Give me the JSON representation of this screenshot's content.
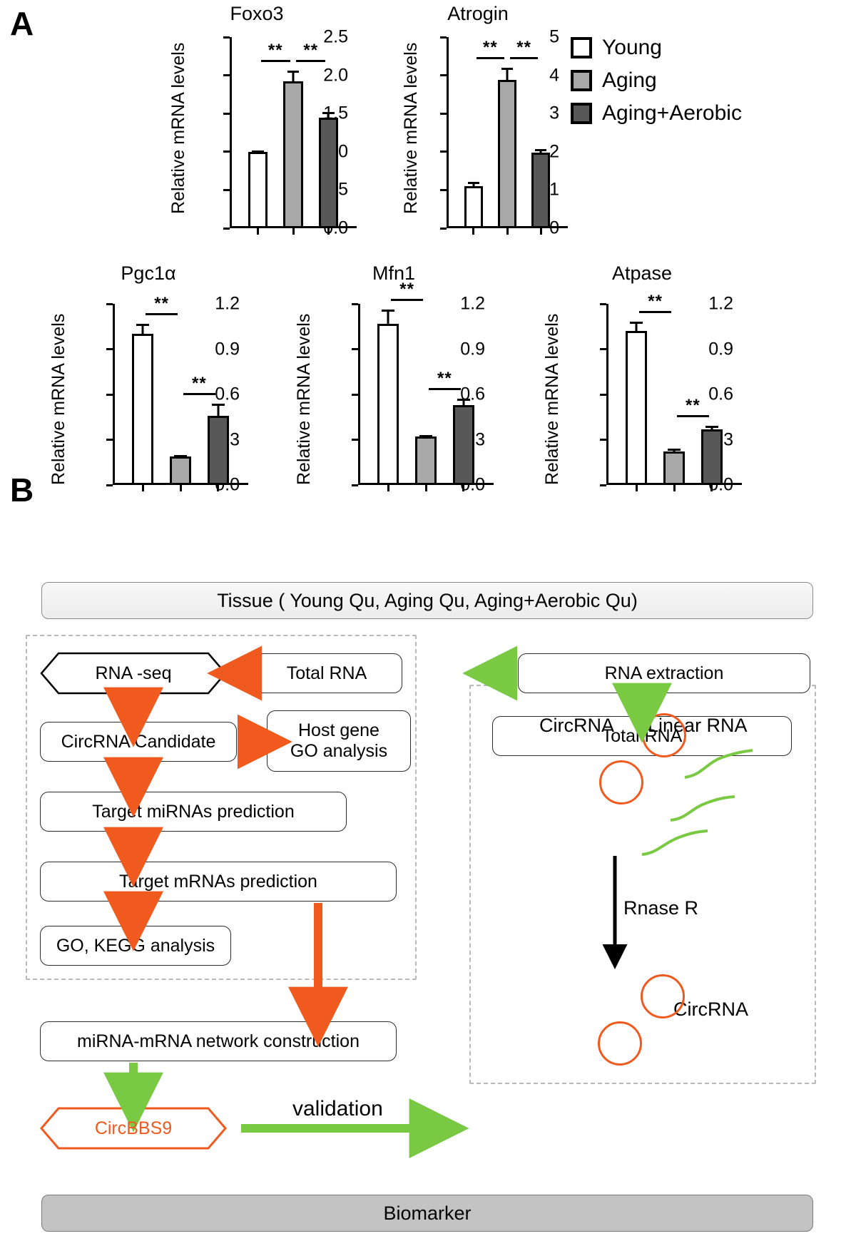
{
  "panels": {
    "a_letter": "A",
    "b_letter": "B"
  },
  "legend": {
    "items": [
      {
        "label": "Young",
        "swatch": "young",
        "color": "#ffffff"
      },
      {
        "label": "Aging",
        "swatch": "aging",
        "color": "#a8a8a8"
      },
      {
        "label": "Aging+Aerobic",
        "swatch": "aero",
        "color": "#585858"
      }
    ]
  },
  "chart_data": [
    {
      "type": "bar",
      "title": "Foxo3",
      "ylabel": "Relative mRNA levels",
      "xlabel": "",
      "categories": [
        "Young",
        "Aging",
        "Aging+Aerobic"
      ],
      "values": [
        1.0,
        1.92,
        1.45
      ],
      "errors": [
        0.02,
        0.14,
        0.07
      ],
      "ylim": [
        0.0,
        2.5
      ],
      "yticks": [
        0.0,
        0.5,
        1.0,
        1.5,
        2.0,
        2.5
      ],
      "yticklabels": [
        "0.0",
        "0.5",
        "1.0",
        "1.5",
        "2.0",
        "2.5"
      ],
      "grid": false,
      "annotations": [
        {
          "text": "**",
          "from": "Young",
          "to": "Aging"
        },
        {
          "text": "**",
          "from": "Aging",
          "to": "Aging+Aerobic"
        }
      ]
    },
    {
      "type": "bar",
      "title": "Atrogin",
      "ylabel": "Relative mRNA levels",
      "xlabel": "",
      "categories": [
        "Young",
        "Aging",
        "Aging+Aerobic"
      ],
      "values": [
        1.1,
        3.88,
        1.97
      ],
      "errors": [
        0.12,
        0.32,
        0.11
      ],
      "ylim": [
        0,
        5
      ],
      "yticks": [
        0,
        1,
        2,
        3,
        4,
        5
      ],
      "yticklabels": [
        "0",
        "1",
        "2",
        "3",
        "4",
        "5"
      ],
      "grid": false,
      "annotations": [
        {
          "text": "**",
          "from": "Young",
          "to": "Aging"
        },
        {
          "text": "**",
          "from": "Aging",
          "to": "Aging+Aerobic"
        }
      ]
    },
    {
      "type": "bar",
      "title": "Pgc1α",
      "ylabel": "Relative mRNA levels",
      "xlabel": "",
      "categories": [
        "Young",
        "Aging",
        "Aging+Aerobic"
      ],
      "values": [
        1.0,
        0.19,
        0.46
      ],
      "errors": [
        0.07,
        0.01,
        0.08
      ],
      "ylim": [
        0.0,
        1.2
      ],
      "yticks": [
        0.0,
        0.3,
        0.6,
        0.9,
        1.2
      ],
      "yticklabels": [
        "0.0",
        "0.3",
        "0.6",
        "0.9",
        "1.2"
      ],
      "grid": false,
      "annotations": [
        {
          "text": "**",
          "from": "Young",
          "to": "Aging"
        },
        {
          "text": "**",
          "from": "Aging",
          "to": "Aging+Aerobic"
        }
      ]
    },
    {
      "type": "bar",
      "title": "Mfn1",
      "ylabel": "Relative mRNA levels",
      "xlabel": "",
      "categories": [
        "Young",
        "Aging",
        "Aging+Aerobic"
      ],
      "values": [
        1.07,
        0.32,
        0.53
      ],
      "errors": [
        0.09,
        0.01,
        0.04
      ],
      "ylim": [
        0.0,
        1.2
      ],
      "yticks": [
        0.0,
        0.3,
        0.6,
        0.9,
        1.2
      ],
      "yticklabels": [
        "0.0",
        "0.3",
        "0.6",
        "0.9",
        "1.2"
      ],
      "grid": false,
      "annotations": [
        {
          "text": "**",
          "from": "Young",
          "to": "Aging"
        },
        {
          "text": "**",
          "from": "Aging",
          "to": "Aging+Aerobic"
        }
      ]
    },
    {
      "type": "bar",
      "title": "Atpase",
      "ylabel": "Relative mRNA levels",
      "xlabel": "",
      "categories": [
        "Young",
        "Aging",
        "Aging+Aerobic"
      ],
      "values": [
        1.02,
        0.22,
        0.37
      ],
      "errors": [
        0.06,
        0.02,
        0.02
      ],
      "ylim": [
        0.0,
        1.2
      ],
      "yticks": [
        0.0,
        0.3,
        0.6,
        0.9,
        1.2
      ],
      "yticklabels": [
        "0.0",
        "0.3",
        "0.6",
        "0.9",
        "1.2"
      ],
      "grid": false,
      "annotations": [
        {
          "text": "**",
          "from": "Young",
          "to": "Aging"
        },
        {
          "text": "**",
          "from": "Aging",
          "to": "Aging+Aerobic"
        }
      ]
    }
  ],
  "flowchart": {
    "tissue_bar": "Tissue ( Young Qu, Aging Qu, Aging+Aerobic Qu)",
    "biomarker_bar": "Biomarker",
    "nodes": {
      "rna_seq": "RNA -seq",
      "total_rna_left": "Total RNA",
      "rna_extraction": "RNA extraction",
      "circrna_candidate": "CircRNA Candidate",
      "host_gene_go": "Host gene\nGO analysis",
      "target_mirnas": "Target miRNAs prediction",
      "target_mrnas": "Target mRNAs prediction",
      "go_kegg": "GO, KEGG analysis",
      "network": "miRNA-mRNA network construction",
      "circbbs9": "CircBBS9",
      "total_rna_right": "Total RNA"
    },
    "labels": {
      "validation": "validation",
      "circrna_top": "CircRNA",
      "linear_rna": "Linear RNA",
      "rnase_r": "Rnase R",
      "circrna_bottom": "CircRNA"
    },
    "colors": {
      "orange": "#f15a1e",
      "green": "#7ac943",
      "black": "#000000",
      "dash_gray": "#b9b9b9"
    }
  }
}
